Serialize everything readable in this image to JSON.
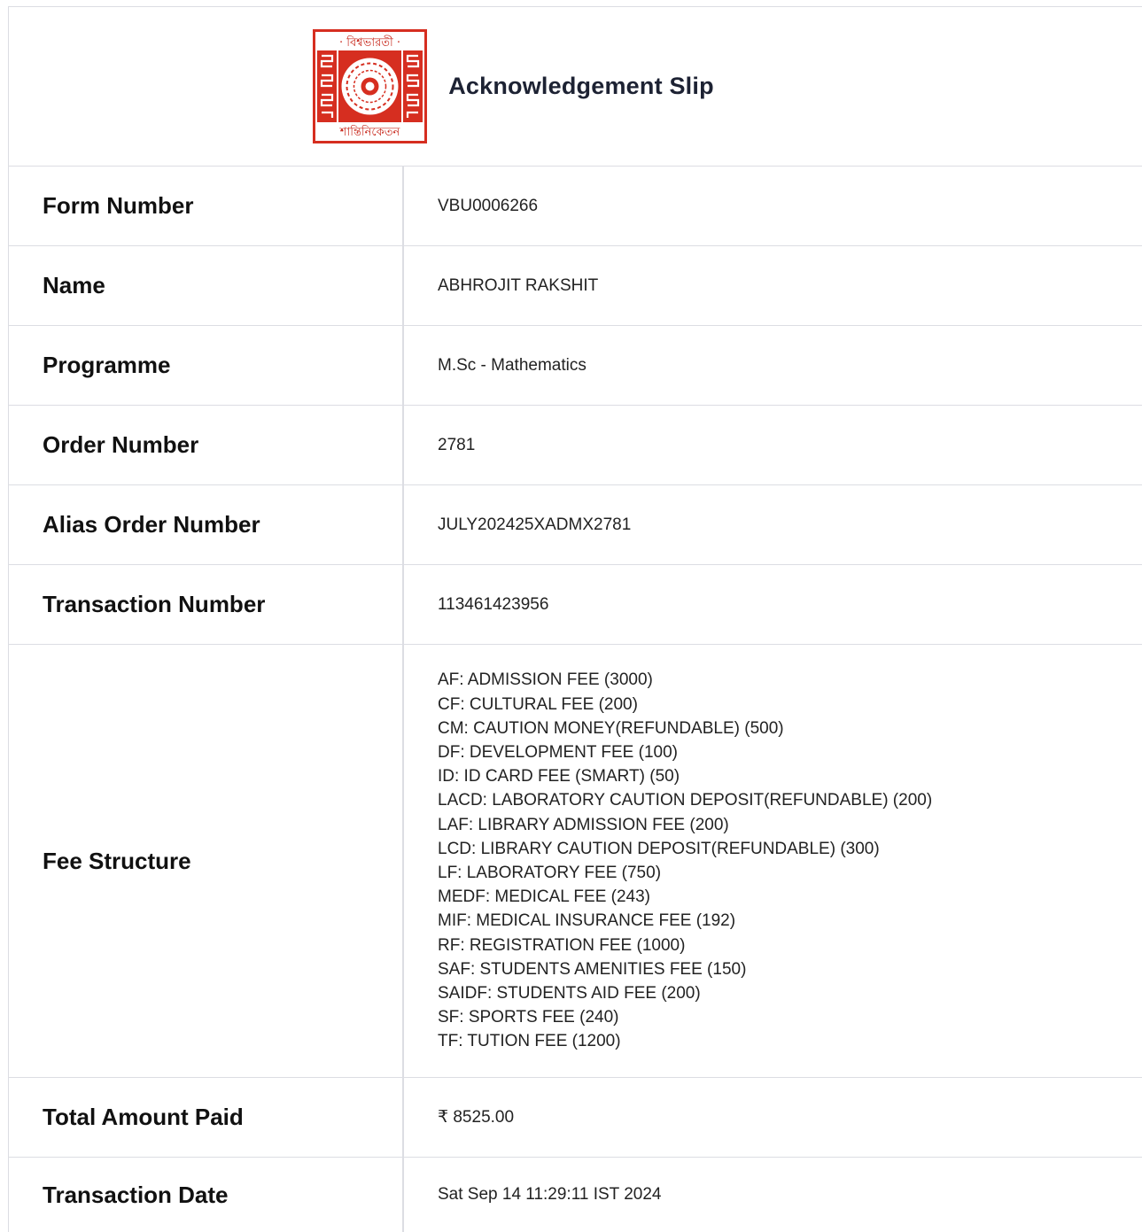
{
  "header": {
    "logo": {
      "top_text": "· বিশ্বভারতী ·",
      "bottom_text": "শান্তিনিকেতন",
      "colors": {
        "background": "#d62e20",
        "frame": "#ffffff",
        "emblem": "#ffffff"
      }
    },
    "title": "Acknowledgement Slip"
  },
  "rows": [
    {
      "label": "Form Number",
      "value": "VBU0006266"
    },
    {
      "label": "Name",
      "value": "ABHROJIT RAKSHIT"
    },
    {
      "label": "Programme",
      "value": "M.Sc - Mathematics"
    },
    {
      "label": "Order Number",
      "value": "2781"
    },
    {
      "label": "Alias Order Number",
      "value": "JULY202425XADMX2781"
    },
    {
      "label": "Transaction Number",
      "value": "113461423956"
    }
  ],
  "fee_structure": {
    "label": "Fee Structure",
    "items": [
      "AF: ADMISSION FEE (3000)",
      "CF: CULTURAL FEE (200)",
      "CM: CAUTION MONEY(REFUNDABLE) (500)",
      "DF: DEVELOPMENT FEE (100)",
      "ID: ID CARD FEE (SMART) (50)",
      "LACD: LABORATORY CAUTION DEPOSIT(REFUNDABLE) (200)",
      "LAF: LIBRARY ADMISSION FEE (200)",
      "LCD: LIBRARY CAUTION DEPOSIT(REFUNDABLE) (300)",
      "LF: LABORATORY FEE (750)",
      "MEDF: MEDICAL FEE (243)",
      "MIF: MEDICAL INSURANCE FEE (192)",
      "RF: REGISTRATION FEE (1000)",
      "SAF: STUDENTS AMENITIES FEE (150)",
      "SAIDF: STUDENTS AID FEE (200)",
      "SF: SPORTS FEE (240)",
      "TF: TUTION FEE (1200)"
    ]
  },
  "total": {
    "label": "Total Amount Paid",
    "value": "₹ 8525.00"
  },
  "transaction_date": {
    "label": "Transaction Date",
    "value": "Sat Sep 14 11:29:11 IST 2024"
  }
}
